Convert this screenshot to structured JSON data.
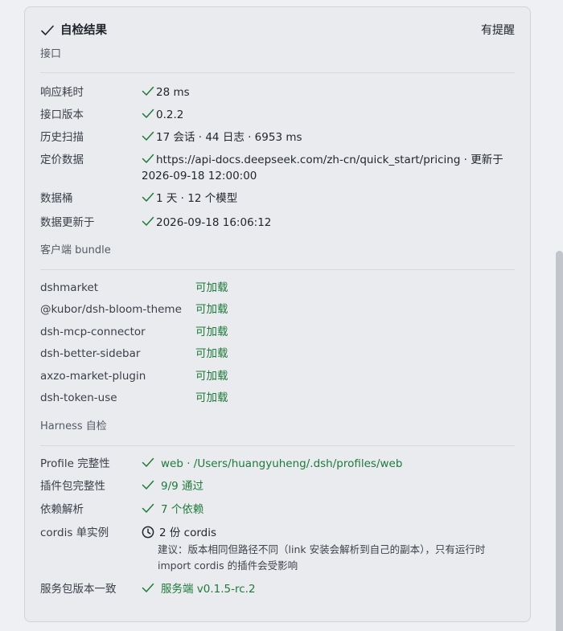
{
  "header": {
    "title": "自检结果",
    "status": "有提醒"
  },
  "sections": {
    "api": {
      "title": "接口",
      "rows": [
        {
          "label": "响应耗时",
          "value": "28 ms"
        },
        {
          "label": "接口版本",
          "value": "0.2.2"
        },
        {
          "label": "历史扫描",
          "value": "17 会话 · 44 日志 · 6953 ms"
        },
        {
          "label": "定价数据",
          "value": "https://api-docs.deepseek.com/zh-cn/quick_start/pricing · 更新于 2026-09-18 12:00:00"
        },
        {
          "label": "数据桶",
          "value": "1 天 · 12 个模型"
        },
        {
          "label": "数据更新于",
          "value": "2026-09-18 16:06:12"
        }
      ]
    },
    "bundle": {
      "title": "客户端 bundle",
      "rows": [
        {
          "label": "dshmarket",
          "value": "可加载"
        },
        {
          "label": "@kubor/dsh-bloom-theme",
          "value": "可加载"
        },
        {
          "label": "dsh-mcp-connector",
          "value": "可加载"
        },
        {
          "label": "dsh-better-sidebar",
          "value": "可加载"
        },
        {
          "label": "axzo-market-plugin",
          "value": "可加载"
        },
        {
          "label": "dsh-token-use",
          "value": "可加载"
        }
      ]
    },
    "harness": {
      "title": "Harness 自检",
      "rows": [
        {
          "label": "Profile 完整性",
          "value": "web · /Users/huangyuheng/.dsh/profiles/web"
        },
        {
          "label": "插件包完整性",
          "value": "9/9 通过"
        },
        {
          "label": "依赖解析",
          "value": "7 个依赖"
        },
        {
          "label": "cordis 单实例",
          "value": "2 份 cordis",
          "note": "建议：版本相同但路径不同（link 安装会解析到自己的副本），只有运行时 import cordis 的插件会受影响"
        },
        {
          "label": "服务包版本一致",
          "value": "服务端 v0.1.5-rc.2"
        }
      ]
    }
  },
  "colors": {
    "ok": "#1f7a3a",
    "background": "#e9ebef",
    "border": "#cfd3da"
  },
  "icons": {
    "check": "check-icon",
    "clock": "clock-icon"
  }
}
